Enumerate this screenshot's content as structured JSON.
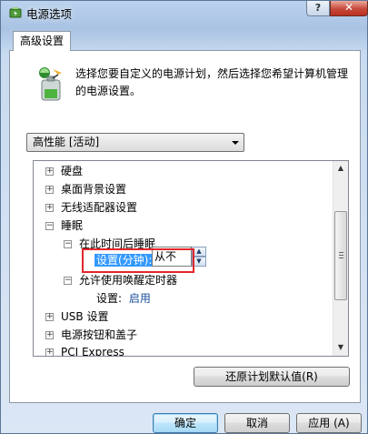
{
  "window": {
    "title": "电源选项",
    "help_label": "?",
    "close_label": "✕"
  },
  "tab": {
    "label": "高级设置"
  },
  "description": "选择您要自定义的电源计划，然后选择您希望计算机管理的电源设置。",
  "plan_select": {
    "value": "高性能 [活动]"
  },
  "tree": {
    "hard_disk": "硬盘",
    "desktop_bg": "桌面背景设置",
    "wireless": "无线适配器设置",
    "sleep": "睡眠",
    "sleep_after": "在此时间后睡眠",
    "setting_minutes": "设置(分钟):",
    "setting_value": "从不",
    "allow_wake": "允许使用唤醒定时器",
    "setting_label": "设置:",
    "setting_enabled": "启用",
    "usb": "USB 设置",
    "power_buttons": "电源按钮和盖子",
    "pci": "PCI Express"
  },
  "buttons": {
    "restore": "还原计划默认值(R)",
    "ok": "确定",
    "cancel": "取消",
    "apply": "应用 (A)"
  },
  "colors": {
    "selection": "#3399ff",
    "highlight_box": "#e3262a",
    "link": "#1a4d9c"
  }
}
